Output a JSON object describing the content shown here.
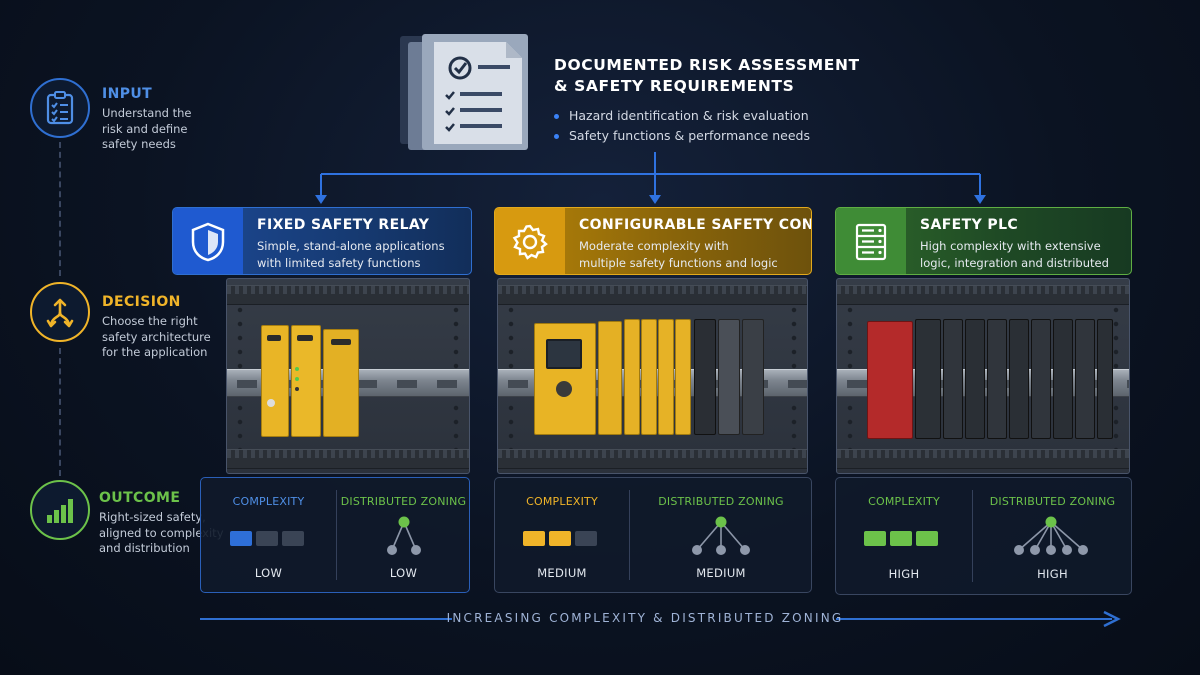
{
  "top": {
    "title_line1": "DOCUMENTED RISK ASSESSMENT",
    "title_line2": "& SAFETY REQUIREMENTS",
    "bullets": [
      "Hazard identification & risk evaluation",
      "Safety functions & performance needs"
    ]
  },
  "timeline": [
    {
      "title": "INPUT",
      "color": "#4f8fe6",
      "icon": "clipboard-checklist-icon",
      "desc": [
        "Understand the",
        "risk and define",
        "safety needs"
      ]
    },
    {
      "title": "DECISION",
      "color": "#f0b429",
      "icon": "branching-arrows-icon",
      "desc": [
        "Choose the right",
        "safety architecture",
        "for the application"
      ]
    },
    {
      "title": "OUTCOME",
      "color": "#6cc24a",
      "icon": "bar-chart-icon",
      "desc": [
        "Right-sized safety,",
        "aligned to complexity",
        "and distribution"
      ]
    }
  ],
  "columns": [
    {
      "title": "FIXED SAFETY RELAY",
      "desc": "Simple, stand-alone applications with limited safety functions",
      "icon": "shield-icon",
      "accent": "#2e6fd8",
      "complexity_label": "COMPLEXITY",
      "complexity_level": 1,
      "complexity_value": "LOW",
      "zoning_label": "DISTRIBUTED ZONING",
      "zoning_branches": 2,
      "zoning_value": "LOW"
    },
    {
      "title": "CONFIGURABLE SAFETY CONTROLLER",
      "desc": "Moderate complexity with multiple safety functions and logic",
      "icon": "gear-icon",
      "accent": "#f0b429",
      "complexity_label": "COMPLEXITY",
      "complexity_level": 2,
      "complexity_value": "MEDIUM",
      "zoning_label": "DISTRIBUTED ZONING",
      "zoning_branches": 3,
      "zoning_value": "MEDIUM"
    },
    {
      "title": "SAFETY PLC",
      "desc": "High complexity with extensive logic, integration and distributed systems",
      "icon": "server-rack-icon",
      "accent": "#6cc24a",
      "complexity_label": "COMPLEXITY",
      "complexity_level": 3,
      "complexity_value": "HIGH",
      "zoning_label": "DISTRIBUTED ZONING",
      "zoning_branches": 5,
      "zoning_value": "HIGH"
    }
  ],
  "bottom_caption": "INCREASING COMPLEXITY & DISTRIBUTED ZONING",
  "colors": {
    "blue": "#2e6fd8",
    "yellow": "#f0b429",
    "green": "#6cc24a",
    "inactive_block": "#3a4455"
  }
}
